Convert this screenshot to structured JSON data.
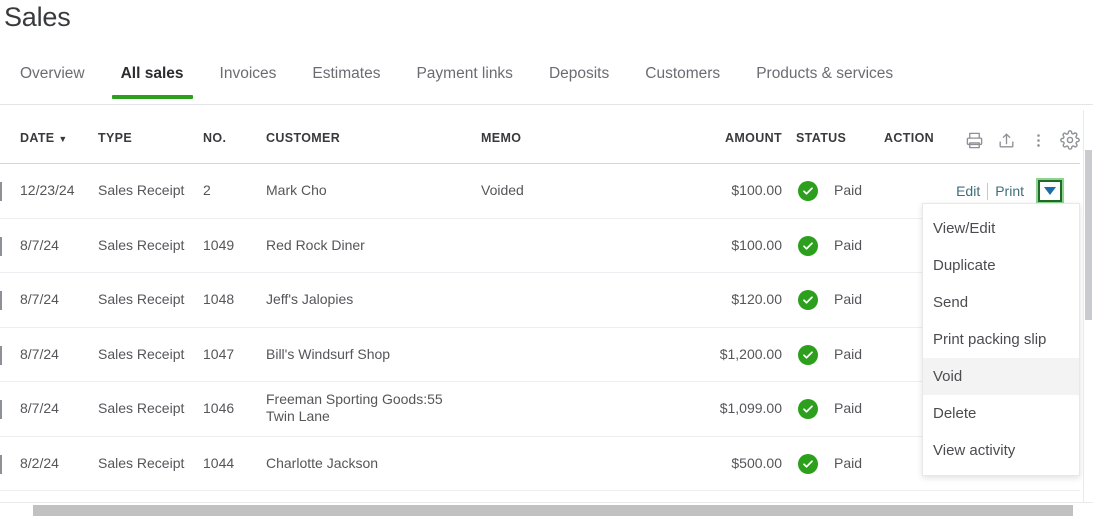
{
  "header": {
    "title": "Sales"
  },
  "tabs": [
    {
      "label": "Overview",
      "active": false
    },
    {
      "label": "All sales",
      "active": true
    },
    {
      "label": "Invoices",
      "active": false
    },
    {
      "label": "Estimates",
      "active": false
    },
    {
      "label": "Payment links",
      "active": false
    },
    {
      "label": "Deposits",
      "active": false
    },
    {
      "label": "Customers",
      "active": false
    },
    {
      "label": "Products & services",
      "active": false
    }
  ],
  "table": {
    "columns": {
      "date": "DATE",
      "date_sort_indicator": "▼",
      "type": "TYPE",
      "no": "NO.",
      "customer": "CUSTOMER",
      "memo": "MEMO",
      "amount": "AMOUNT",
      "status": "STATUS",
      "action": "ACTION"
    },
    "toolbar": [
      {
        "icon": "print-icon"
      },
      {
        "icon": "export-icon"
      },
      {
        "icon": "more-vertical-icon"
      },
      {
        "icon": "gear-icon"
      }
    ],
    "row_actions": {
      "edit": "Edit",
      "print": "Print"
    },
    "rows": [
      {
        "date": "12/23/24",
        "type": "Sales Receipt",
        "no": "2",
        "customer": "Mark Cho",
        "memo": "Voided",
        "amount": "$100.00",
        "status": "Paid",
        "has_actions": true
      },
      {
        "date": "8/7/24",
        "type": "Sales Receipt",
        "no": "1049",
        "customer": "Red Rock Diner",
        "memo": "",
        "amount": "$100.00",
        "status": "Paid",
        "has_actions": false
      },
      {
        "date": "8/7/24",
        "type": "Sales Receipt",
        "no": "1048",
        "customer": "Jeff's Jalopies",
        "memo": "",
        "amount": "$120.00",
        "status": "Paid",
        "has_actions": false
      },
      {
        "date": "8/7/24",
        "type": "Sales Receipt",
        "no": "1047",
        "customer": "Bill's Windsurf Shop",
        "memo": "",
        "amount": "$1,200.00",
        "status": "Paid",
        "has_actions": false
      },
      {
        "date": "8/7/24",
        "type": "Sales Receipt",
        "no": "1046",
        "customer": "Freeman Sporting Goods:55 Twin Lane",
        "memo": "",
        "amount": "$1,099.00",
        "status": "Paid",
        "has_actions": false
      },
      {
        "date": "8/2/24",
        "type": "Sales Receipt",
        "no": "1044",
        "customer": "Charlotte Jackson",
        "memo": "",
        "amount": "$500.00",
        "status": "Paid",
        "has_actions": false
      }
    ]
  },
  "action_menu": {
    "items": [
      {
        "label": "View/Edit",
        "hovered": false
      },
      {
        "label": "Duplicate",
        "hovered": false
      },
      {
        "label": "Send",
        "hovered": false
      },
      {
        "label": "Print packing slip",
        "hovered": false
      },
      {
        "label": "Void",
        "hovered": true
      },
      {
        "label": "Delete",
        "hovered": false
      },
      {
        "label": "View activity",
        "hovered": false
      }
    ]
  },
  "colors": {
    "accent_green": "#2ca01c",
    "link_teal": "#3f6e78",
    "text_dark": "#393a3d",
    "text_muted": "#6b6c72",
    "focus_green": "#1f6b2a"
  }
}
